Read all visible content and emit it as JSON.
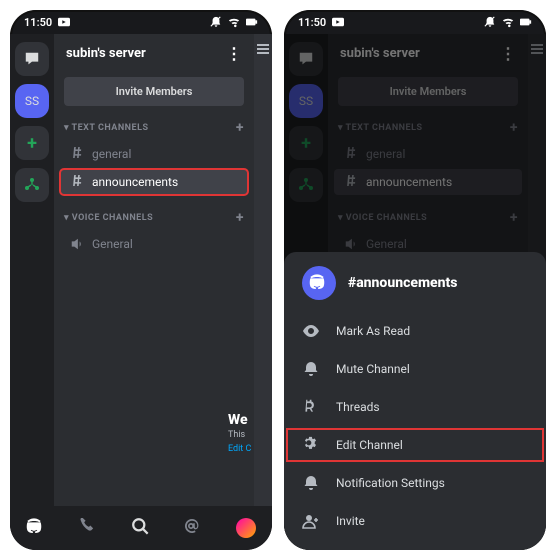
{
  "status": {
    "time": "11:50"
  },
  "server": {
    "name": "subin's server",
    "initials": "SS",
    "invite_label": "Invite Members"
  },
  "categories": {
    "text_label": "TEXT CHANNELS",
    "voice_label": "VOICE CHANNELS"
  },
  "channels": {
    "general": "general",
    "announcements": "announcements",
    "voice_general": "General"
  },
  "welcome": {
    "title": "We",
    "sub": "This",
    "link": "Edit C"
  },
  "sheet": {
    "title": "#announcements",
    "items": {
      "mark_read": "Mark As Read",
      "mute": "Mute Channel",
      "threads": "Threads",
      "edit": "Edit Channel",
      "notif": "Notification Settings",
      "invite": "Invite"
    }
  }
}
